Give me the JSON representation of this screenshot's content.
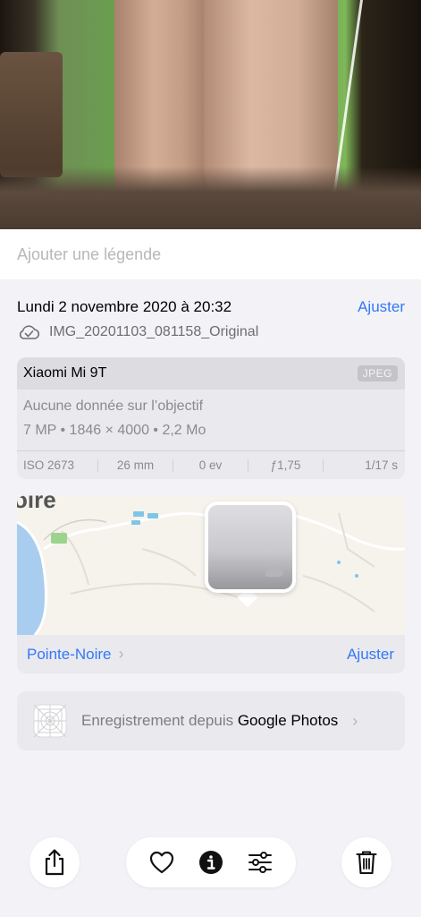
{
  "caption": {
    "placeholder": "Ajouter une légende"
  },
  "info": {
    "date": "Lundi 2 novembre 2020 à 20:32",
    "adjust_label": "Ajuster",
    "filename": "IMG_20201103_081158_Original"
  },
  "camera": {
    "model": "Xiaomi Mi 9T",
    "format": "JPEG",
    "lens": "Aucune donnée sur l’objectif",
    "specs": "7 MP • 1846 × 4000 • 2,2 Mo",
    "exif": {
      "iso": "ISO 2673",
      "focal": "26 mm",
      "ev": "0 ev",
      "aperture": "ƒ1,75",
      "shutter": "1/17 s"
    }
  },
  "map": {
    "corner_label": "oire",
    "place": "Pointe-Noire",
    "adjust_label": "Ajuster"
  },
  "import": {
    "prefix": "Enregistrement depuis",
    "source": "Google Photos"
  },
  "toolbar": {
    "icons": [
      "share-icon",
      "heart-icon",
      "info-icon",
      "adjust-sliders-icon",
      "trash-icon"
    ]
  },
  "colors": {
    "accent": "#3478f6",
    "background": "#f2f2f7",
    "card": "#e9e9ee"
  }
}
